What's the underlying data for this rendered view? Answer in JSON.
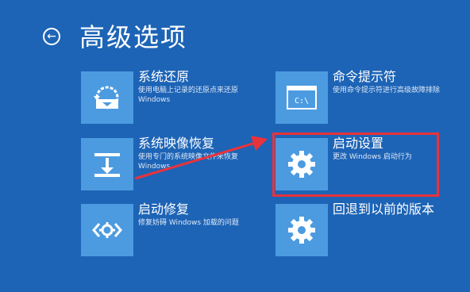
{
  "header": {
    "title": "高级选项",
    "back_icon": "back-arrow-circle-icon"
  },
  "options": [
    {
      "id": "system-restore",
      "title": "系统还原",
      "description": "使用电脑上记录的还原点来还原 Windows",
      "icon": "restore-icon"
    },
    {
      "id": "system-image-recovery",
      "title": "系统映像恢复",
      "description": "使用专门的系统映像文件来恢复 Windows",
      "icon": "image-recovery-icon"
    },
    {
      "id": "startup-repair",
      "title": "启动修复",
      "description": "修复妨碍 Windows 加载的问题",
      "icon": "startup-repair-icon"
    },
    {
      "id": "command-prompt",
      "title": "命令提示符",
      "description": "使用命令提示符进行高级故障排除",
      "icon": "command-prompt-icon"
    },
    {
      "id": "startup-settings",
      "title": "启动设置",
      "description": "更改 Windows 启动行为",
      "icon": "gear-icon"
    },
    {
      "id": "go-back",
      "title": "回退到以前的版本",
      "description": "",
      "icon": "gear-icon"
    }
  ],
  "colors": {
    "background": "#1d64b6",
    "tile": "#4c9be0",
    "highlight_border": "#e8333b",
    "annotation_arrow": "#e8333b"
  }
}
